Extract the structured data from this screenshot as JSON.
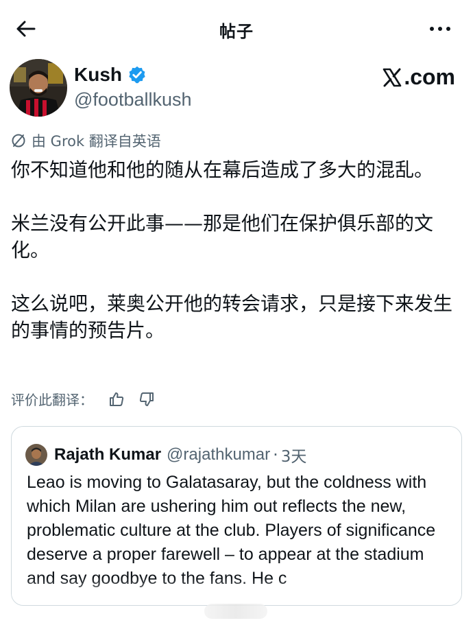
{
  "topbar": {
    "title": "帖子",
    "back_icon": "arrow-left-icon",
    "more_icon": "more-dots-icon"
  },
  "author": {
    "name": "Kush",
    "handle": "@footballkush",
    "verified": true,
    "verified_color": "#1d9bf0"
  },
  "brand": {
    "label": ".com",
    "logo_icon": "x-logo-icon"
  },
  "translation": {
    "note": "由 Grok 翻译自英语",
    "rate_label": "评价此翻译："
  },
  "tweet": {
    "paragraphs": [
      "你不知道他和他的随从在幕后造成了多大的混乱。",
      "米兰没有公开此事——那是他们在保护俱乐部的文化。",
      "这么说吧，莱奥公开他的转会请求，只是接下来发生的事情的预告片。"
    ]
  },
  "quote": {
    "name": "Rajath Kumar",
    "handle": "@rajathkumar",
    "separator": "·",
    "time": "3天",
    "text": "Leao is moving to Galatasaray, but the coldness with which Milan are ushering him out reflects the new, problematic culture at the club. Players of significance deserve a proper farewell – to appear at the stadium and say goodbye to the fans. He c"
  },
  "colors": {
    "text_primary": "#0f1419",
    "text_secondary": "#536471",
    "border": "#cfd9de",
    "accent": "#1d9bf0"
  }
}
